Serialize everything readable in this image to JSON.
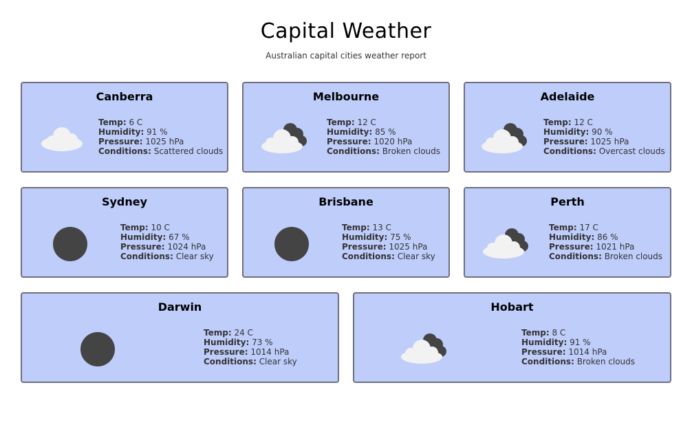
{
  "header": {
    "title": "Capital Weather",
    "subtitle": "Australian capital cities weather report"
  },
  "labels": {
    "temp": "Temp:",
    "humidity": "Humidity:",
    "pressure": "Pressure:",
    "conditions": "Conditions:"
  },
  "colors": {
    "card_bg": "#bfcdfb",
    "card_border": "#6e6e80",
    "cloud_light": "#f2f2f2",
    "cloud_dark": "#444444",
    "sun": "#444444"
  },
  "cities": [
    {
      "name": "Canberra",
      "temp": "6 C",
      "humidity": "91 %",
      "pressure": "1025 hPa",
      "conditions": "Scattered clouds",
      "icon": "scattered-clouds-icon"
    },
    {
      "name": "Melbourne",
      "temp": "12 C",
      "humidity": "85 %",
      "pressure": "1020 hPa",
      "conditions": "Broken clouds",
      "icon": "broken-clouds-icon"
    },
    {
      "name": "Adelaide",
      "temp": "12 C",
      "humidity": "90 %",
      "pressure": "1025 hPa",
      "conditions": "Overcast clouds",
      "icon": "broken-clouds-icon"
    },
    {
      "name": "Sydney",
      "temp": "10 C",
      "humidity": "67 %",
      "pressure": "1024 hPa",
      "conditions": "Clear sky",
      "icon": "clear-sky-icon"
    },
    {
      "name": "Brisbane",
      "temp": "13 C",
      "humidity": "75 %",
      "pressure": "1025 hPa",
      "conditions": "Clear sky",
      "icon": "clear-sky-icon"
    },
    {
      "name": "Perth",
      "temp": "17 C",
      "humidity": "86 %",
      "pressure": "1021 hPa",
      "conditions": "Broken clouds",
      "icon": "broken-clouds-icon"
    },
    {
      "name": "Darwin",
      "temp": "24 C",
      "humidity": "73 %",
      "pressure": "1014 hPa",
      "conditions": "Clear sky",
      "icon": "clear-sky-icon"
    },
    {
      "name": "Hobart",
      "temp": "8 C",
      "humidity": "91 %",
      "pressure": "1014 hPa",
      "conditions": "Broken clouds",
      "icon": "broken-clouds-icon"
    }
  ]
}
